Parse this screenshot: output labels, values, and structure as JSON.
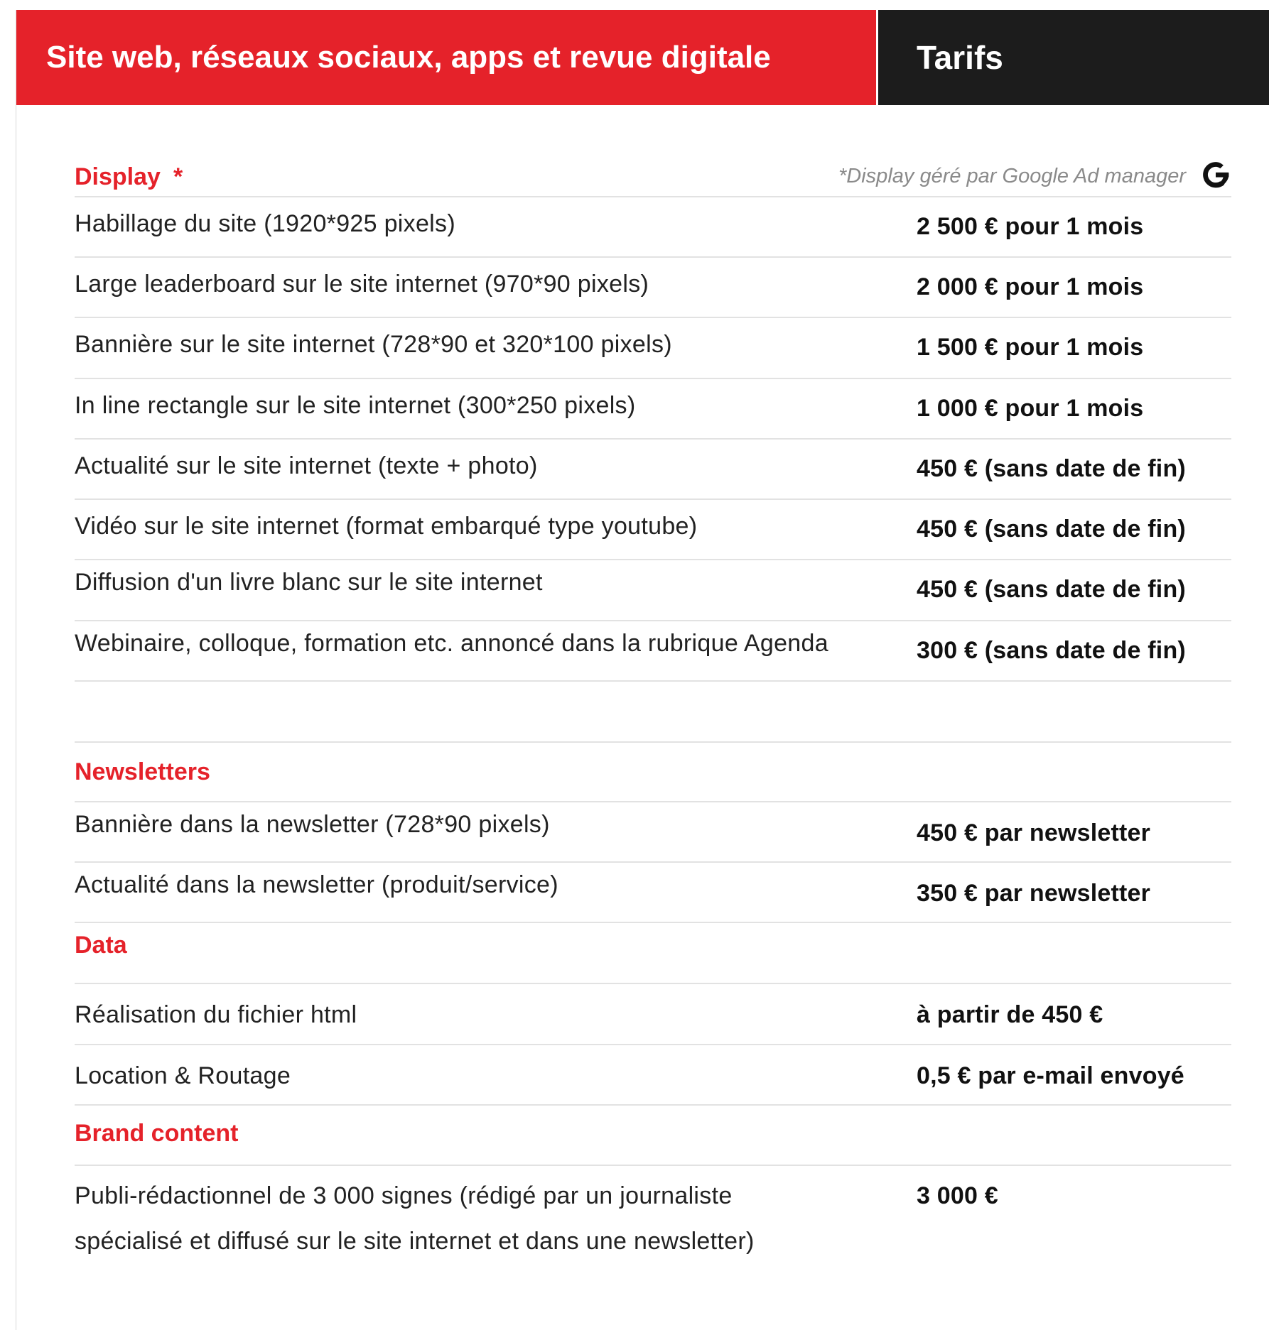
{
  "header": {
    "left_title": "Site web, réseaux sociaux, apps et revue digitale",
    "right_title": "Tarifs"
  },
  "colors": {
    "accent_red": "#e5222a",
    "header_dark": "#1c1c1c"
  },
  "display": {
    "title": "Display",
    "star": "*",
    "note": "*Display géré par Google Ad manager",
    "note_icon": "google-g-icon",
    "rows": [
      {
        "label": "Habillage du site  (1920*925 pixels)",
        "price": "2 500 € pour 1 mois"
      },
      {
        "label": "Large leaderboard sur le site internet  (970*90 pixels)",
        "price": "2 000 € pour 1 mois"
      },
      {
        "label": "Bannière sur le site internet (728*90 et 320*100 pixels)",
        "price": "1 500 € pour 1 mois"
      },
      {
        "label": "In line rectangle sur le site internet (300*250 pixels)",
        "price": "1 000 € pour 1 mois"
      },
      {
        "label": "Actualité sur le site internet (texte + photo)",
        "price": "450 € (sans date de fin)"
      },
      {
        "label": "Vidéo sur le site internet (format embarqué type youtube)",
        "price": "450 € (sans date de fin)"
      },
      {
        "label": "Diffusion d'un livre blanc sur le site internet",
        "price": "450 € (sans date de fin)"
      },
      {
        "label": "Webinaire, colloque, formation etc. annoncé dans la rubrique Agenda",
        "price": "300 € (sans date de fin)"
      }
    ]
  },
  "newsletters": {
    "title": "Newsletters",
    "rows": [
      {
        "label": "Bannière dans la newsletter (728*90 pixels)",
        "price": "450 € par newsletter"
      },
      {
        "label": "Actualité dans la newsletter (produit/service)",
        "price": "350 € par newsletter"
      }
    ]
  },
  "data_section": {
    "title": "Data",
    "rows": [
      {
        "label": "Réalisation du fichier html",
        "price": "à partir de 450 €"
      },
      {
        "label": "Location & Routage",
        "price": "0,5 € par e-mail envoyé"
      }
    ]
  },
  "brand_content": {
    "title": "Brand content",
    "rows": [
      {
        "label_line1": "Publi-rédactionnel de 3 000 signes (rédigé par un journaliste",
        "label_line2": "spécialisé et diffusé sur le site internet et dans une newsletter)",
        "price": "3 000 €"
      }
    ]
  }
}
